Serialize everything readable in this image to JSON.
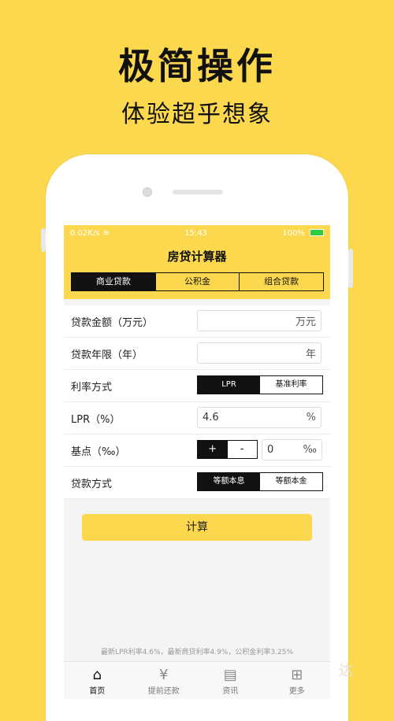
{
  "promo": {
    "headline": "极简操作",
    "subheadline": "体验超乎想象"
  },
  "status": {
    "network": "0.02K/s",
    "time": "15:43",
    "battery": "100%"
  },
  "app": {
    "title": "房贷计算器"
  },
  "loan_tabs": [
    {
      "label": "商业贷款",
      "active": true
    },
    {
      "label": "公积金",
      "active": false
    },
    {
      "label": "组合贷款",
      "active": false
    }
  ],
  "form": {
    "amount": {
      "label": "贷款金额（万元）",
      "value": "",
      "unit": "万元"
    },
    "years": {
      "label": "贷款年限（年）",
      "value": "",
      "unit": "年"
    },
    "rate_method": {
      "label": "利率方式",
      "options": [
        "LPR",
        "基准利率"
      ],
      "selected": "LPR"
    },
    "lpr": {
      "label": "LPR（%）",
      "value": "4.6",
      "unit": "%"
    },
    "basis": {
      "label": "基点（‰）",
      "plus": "+",
      "minus": "-",
      "value": "0",
      "unit": "‰"
    },
    "repay_method": {
      "label": "贷款方式",
      "options": [
        "等额本息",
        "等额本金"
      ],
      "selected": "等额本息"
    }
  },
  "calculate_label": "计算",
  "footnote": "最新LPR利率4.6%，最新商贷利率4.9%，公积金利率3.25%",
  "tabbar": [
    {
      "label": "首页",
      "icon": "home-icon",
      "active": true
    },
    {
      "label": "提前还款",
      "icon": "money-icon",
      "active": false
    },
    {
      "label": "资讯",
      "icon": "news-icon",
      "active": false
    },
    {
      "label": "更多",
      "icon": "grid-icon",
      "active": false
    }
  ],
  "watermark": "达",
  "colors": {
    "accent": "#FCD84E",
    "dark": "#111111"
  }
}
